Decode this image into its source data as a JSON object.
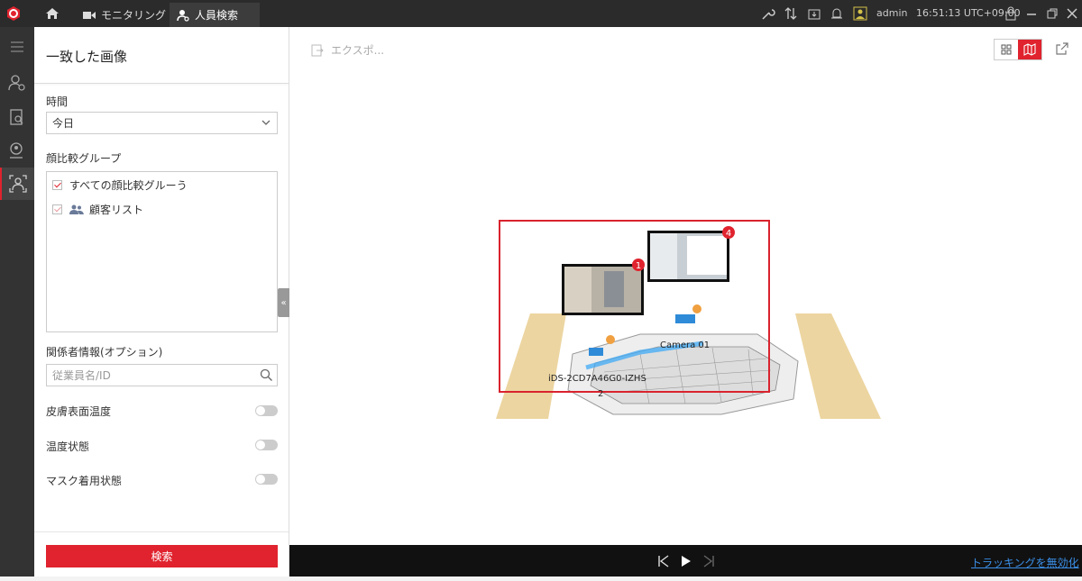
{
  "app": {
    "tabs": [
      {
        "label": "モニタリング",
        "active": false
      },
      {
        "label": "人員検索",
        "active": true
      }
    ],
    "user": "admin",
    "time": "16:51:13 UTC+09:00"
  },
  "panel": {
    "title": "一致した画像",
    "time_label": "時間",
    "time_value": "今日",
    "group_label": "顔比較グループ",
    "groups": [
      {
        "label": "すべての顔比較グルーう",
        "checked": true
      },
      {
        "label": "顧客リスト",
        "checked": true
      }
    ],
    "person_info_label": "関係者情報(オプション)",
    "person_placeholder": "従業員名/ID",
    "toggles": [
      {
        "label": "皮膚表面温度",
        "on": false
      },
      {
        "label": "温度状態",
        "on": false
      },
      {
        "label": "マスク着用状態",
        "on": false
      }
    ],
    "search_button": "検索"
  },
  "main": {
    "export_label": "エクスポ...",
    "map": {
      "camera_label": "Camera 01",
      "device_label": "iDS-2CD7A46G0-IZHS",
      "device_number": "2",
      "badges": [
        "1",
        "4"
      ]
    }
  },
  "playbar": {
    "disable_tracking_label": "トラッキングを無効化"
  },
  "colors": {
    "accent": "#e0232e",
    "topbar": "#2b2b2b",
    "link": "#3a8ee6"
  }
}
